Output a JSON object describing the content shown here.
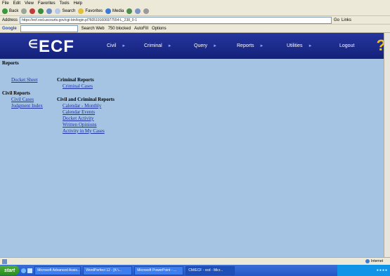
{
  "menubar": {
    "items": [
      "File",
      "Edit",
      "View",
      "Favorites",
      "Tools",
      "Help"
    ]
  },
  "toolbar": {
    "back": "Back",
    "search": "Search",
    "favorites": "Favorites",
    "media": "Media"
  },
  "addressbar": {
    "label": "Address",
    "url": "https://ecf.xxd.uscourts.gov/cgi-bin/login.pl?605191606977554-L_238_0-1",
    "go": "Go",
    "links": "Links"
  },
  "googlebar": {
    "logo": "Google",
    "search_web": "Search Web",
    "popup": "750 blocked",
    "autofill": "AutoFill",
    "options": "Options"
  },
  "ecf": {
    "logo": "ECF",
    "nav": [
      "Civil",
      "Criminal",
      "Query",
      "Reports",
      "Utilities",
      "Logout"
    ],
    "help": "?"
  },
  "page": {
    "title": "Reports",
    "docket_sheet": "Docket Sheet",
    "criminal_reports_hdr": "Criminal Reports",
    "criminal_cases": "Criminal Cases",
    "civil_reports_hdr": "Civil Reports",
    "civil_cases": "Civil Cases",
    "judgment_index": "Judgment Index",
    "civil_criminal_hdr": "Civil and Criminal Reports",
    "cc_links": [
      "Calendar - Monthly",
      "Calendar Events",
      "Docket Activity",
      "Written Opinions",
      "Activity in My Cases"
    ]
  },
  "statusbar": {
    "zone": "Internet"
  },
  "taskbar": {
    "start": "start",
    "tasks": [
      "Microsoft Advanced Assis...",
      "WordPerfect 12 - [K:\\...",
      "Microsoft PowerPoint - ...",
      "CM/ECF - xxd - Micr..."
    ]
  },
  "colors": {
    "ecf_bar": "#1c2b8c",
    "content_bg": "#a5c3e2",
    "link": "#1a2fa6"
  }
}
